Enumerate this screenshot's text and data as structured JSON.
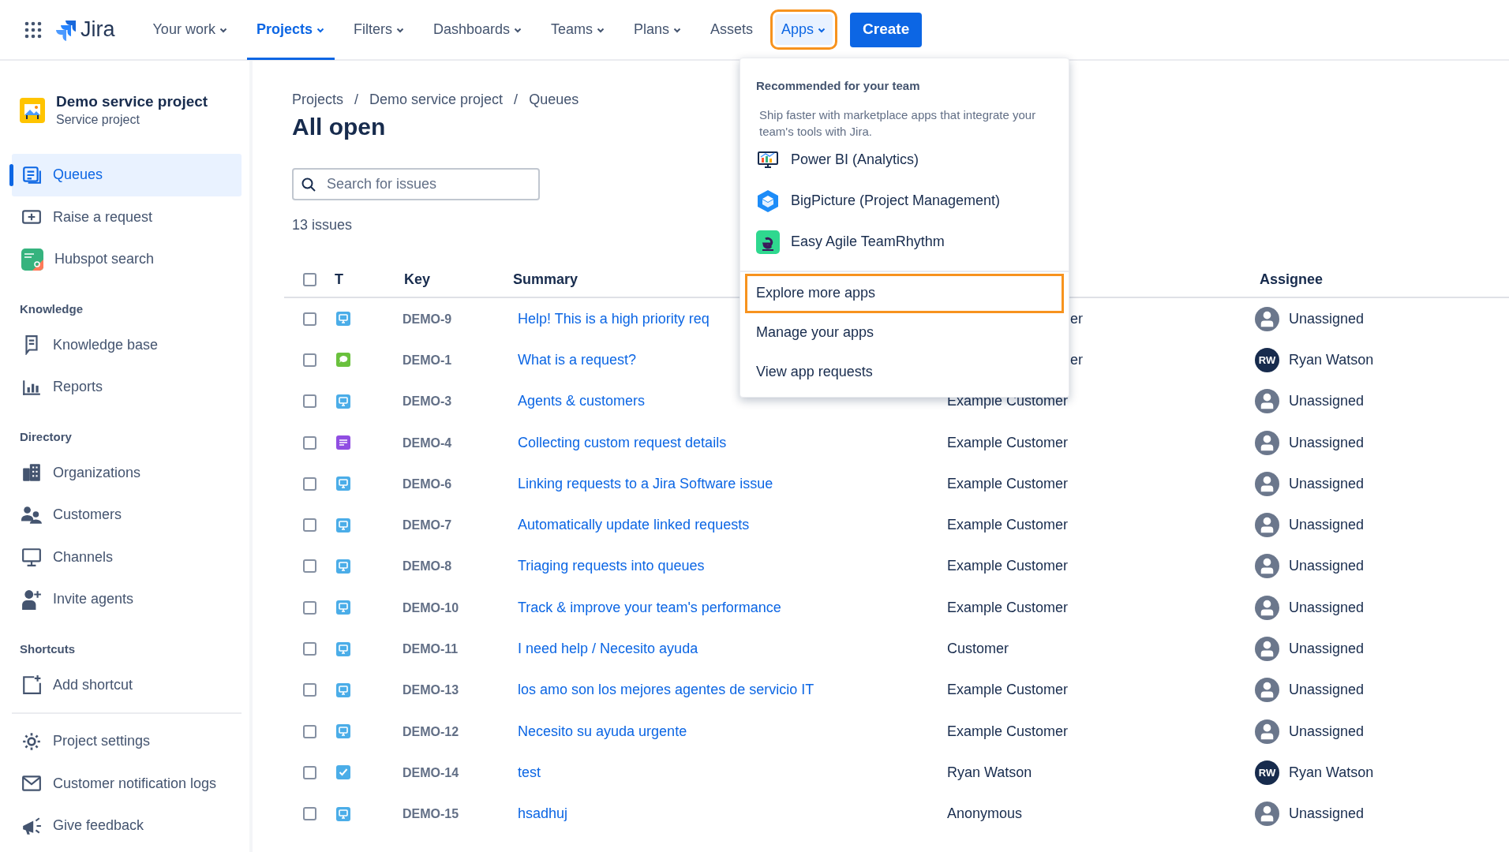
{
  "nav": {
    "product": "Jira",
    "items": [
      {
        "label": "Your work",
        "caret": true,
        "selected": false,
        "open": false,
        "highlighted": false
      },
      {
        "label": "Projects",
        "caret": true,
        "selected": true,
        "open": false,
        "highlighted": false
      },
      {
        "label": "Filters",
        "caret": true,
        "selected": false,
        "open": false,
        "highlighted": false
      },
      {
        "label": "Dashboards",
        "caret": true,
        "selected": false,
        "open": false,
        "highlighted": false
      },
      {
        "label": "Teams",
        "caret": true,
        "selected": false,
        "open": false,
        "highlighted": false
      },
      {
        "label": "Plans",
        "caret": true,
        "selected": false,
        "open": false,
        "highlighted": false
      },
      {
        "label": "Assets",
        "caret": false,
        "selected": false,
        "open": false,
        "highlighted": false
      },
      {
        "label": "Apps",
        "caret": true,
        "selected": false,
        "open": true,
        "highlighted": true
      }
    ],
    "create": "Create"
  },
  "sidebar": {
    "project": {
      "name": "Demo service project",
      "type": "Service project"
    },
    "sections": [
      {
        "items": [
          {
            "label": "Queues",
            "selected": true
          },
          {
            "label": "Raise a request",
            "selected": false
          },
          {
            "label": "Hubspot search",
            "selected": false
          }
        ]
      },
      {
        "heading": "Knowledge",
        "items": [
          {
            "label": "Knowledge base",
            "selected": false
          },
          {
            "label": "Reports",
            "selected": false
          }
        ]
      },
      {
        "heading": "Directory",
        "items": [
          {
            "label": "Organizations",
            "selected": false
          },
          {
            "label": "Customers",
            "selected": false
          },
          {
            "label": "Channels",
            "selected": false
          },
          {
            "label": "Invite agents",
            "selected": false
          }
        ]
      },
      {
        "heading": "Shortcuts",
        "items": [
          {
            "label": "Add shortcut",
            "selected": false
          }
        ]
      },
      {
        "divider": true,
        "items": [
          {
            "label": "Project settings",
            "selected": false
          },
          {
            "label": "Customer notification logs",
            "selected": false
          },
          {
            "label": "Give feedback",
            "selected": false
          }
        ]
      }
    ]
  },
  "breadcrumbs": [
    "Projects",
    "Demo service project",
    "Queues"
  ],
  "breadcrumb_separator": "/",
  "title": "All open",
  "search": {
    "placeholder": "Search for issues"
  },
  "count": "13 issues",
  "table": {
    "select_all_checked": false,
    "columns": [
      "T",
      "Key",
      "Summary",
      "Assignee"
    ],
    "rows": [
      {
        "checked": false,
        "kind": "service",
        "key": "DEMO-9",
        "summary": "Help! This is a high priority req",
        "reporter": "er",
        "reporter_partly_hidden": true,
        "assignee": "Unassigned"
      },
      {
        "checked": false,
        "kind": "question",
        "key": "DEMO-1",
        "summary": "What is a request?",
        "reporter": "er",
        "reporter_partly_hidden": true,
        "assignee": "Ryan Watson",
        "initials": "RW"
      },
      {
        "checked": false,
        "kind": "service",
        "key": "DEMO-3",
        "summary": "Agents & customers",
        "reporter": "Example Customer",
        "reporter_partly_hidden": false,
        "assignee": "Unassigned"
      },
      {
        "checked": false,
        "kind": "note",
        "key": "DEMO-4",
        "summary": "Collecting custom request details",
        "reporter": "Example Customer",
        "reporter_partly_hidden": false,
        "assignee": "Unassigned"
      },
      {
        "checked": false,
        "kind": "service",
        "key": "DEMO-6",
        "summary": "Linking requests to a Jira Software issue",
        "reporter": "Example Customer",
        "reporter_partly_hidden": false,
        "assignee": "Unassigned"
      },
      {
        "checked": false,
        "kind": "service",
        "key": "DEMO-7",
        "summary": "Automatically update linked requests",
        "reporter": "Example Customer",
        "reporter_partly_hidden": false,
        "assignee": "Unassigned"
      },
      {
        "checked": false,
        "kind": "service",
        "key": "DEMO-8",
        "summary": "Triaging requests into queues",
        "reporter": "Example Customer",
        "reporter_partly_hidden": false,
        "assignee": "Unassigned"
      },
      {
        "checked": false,
        "kind": "service",
        "key": "DEMO-10",
        "summary": "Track & improve your team's performance",
        "reporter": "Example Customer",
        "reporter_partly_hidden": false,
        "assignee": "Unassigned"
      },
      {
        "checked": false,
        "kind": "service",
        "key": "DEMO-11",
        "summary": "I need help / Necesito ayuda",
        "reporter": "Customer",
        "reporter_partly_hidden": false,
        "assignee": "Unassigned"
      },
      {
        "checked": false,
        "kind": "service",
        "key": "DEMO-13",
        "summary": "los amo son los mejores agentes de servicio IT",
        "reporter": "Example Customer",
        "reporter_partly_hidden": false,
        "assignee": "Unassigned"
      },
      {
        "checked": false,
        "kind": "service",
        "key": "DEMO-12",
        "summary": "Necesito su ayuda urgente",
        "reporter": "Example Customer",
        "reporter_partly_hidden": false,
        "assignee": "Unassigned"
      },
      {
        "checked": false,
        "kind": "task",
        "key": "DEMO-14",
        "summary": "test",
        "reporter": "Ryan Watson",
        "reporter_partly_hidden": false,
        "assignee": "Ryan Watson",
        "initials": "RW"
      },
      {
        "checked": false,
        "kind": "service",
        "key": "DEMO-15",
        "summary": "hsadhuj",
        "reporter": "Anonymous",
        "reporter_partly_hidden": false,
        "assignee": "Unassigned"
      }
    ]
  },
  "apps_menu": {
    "heading": "Recommended for your team",
    "description": "Ship faster with marketplace apps that integrate your team's tools with Jira.",
    "apps": [
      "Power BI (Analytics)",
      "BigPicture (Project Management)",
      "Easy Agile TeamRhythm"
    ],
    "actions": [
      {
        "label": "Explore more apps",
        "highlighted": true
      },
      {
        "label": "Manage your apps",
        "highlighted": false
      },
      {
        "label": "View app requests",
        "highlighted": false
      }
    ]
  }
}
